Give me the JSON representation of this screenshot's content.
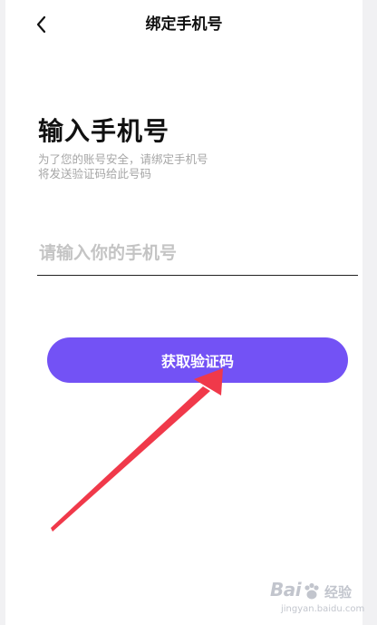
{
  "nav": {
    "title": "绑定手机号",
    "back_icon": "chevron-left-icon"
  },
  "main": {
    "heading": "输入手机号",
    "hint_lines": [
      "为了您的账号安全，请绑定手机号",
      "将发送验证码给此号码"
    ],
    "phone_input": {
      "value": "",
      "placeholder": "请输入你的手机号"
    },
    "get_code_label": "获取验证码"
  },
  "annotation": {
    "type": "red-arrow",
    "color": "#f0394a",
    "points_to": "获取验证码"
  },
  "watermark": {
    "brand": "Bai",
    "name": "经验",
    "url": "jingyan.baidu.com"
  },
  "colors": {
    "accent": "#7352f5",
    "text": "#111111",
    "hint": "#a6a6a6",
    "placeholder": "#c4c4c4",
    "sidebar_bg": "#f1f1f3"
  }
}
